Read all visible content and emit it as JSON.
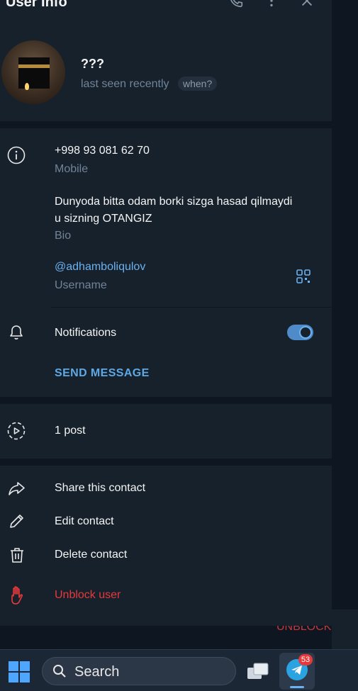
{
  "header": {
    "title": "User Info"
  },
  "profile": {
    "name": "???",
    "status": "last seen recently",
    "when_badge": "when?"
  },
  "info": {
    "phone": "+998 93 081 62 70",
    "phone_label": "Mobile",
    "bio": "Dunyoda bitta odam borki sizga hasad qilmaydi u sizning OTANGIZ",
    "bio_label": "Bio",
    "username": "@adhamboliqulov",
    "username_label": "Username"
  },
  "notifications": {
    "label": "Notifications",
    "enabled": true
  },
  "send_message": "SEND MESSAGE",
  "posts": {
    "label": "1 post"
  },
  "actions": {
    "share": "Share this contact",
    "edit": "Edit contact",
    "delete": "Delete contact",
    "unblock": "Unblock user"
  },
  "background": {
    "unblock_label": "UNBLOCK"
  },
  "taskbar": {
    "search_label": "Search",
    "telegram_badge": "53"
  },
  "colors": {
    "panel": "#17212b",
    "accent": "#6ab2f2",
    "danger": "#e5393c",
    "muted": "#708499"
  }
}
